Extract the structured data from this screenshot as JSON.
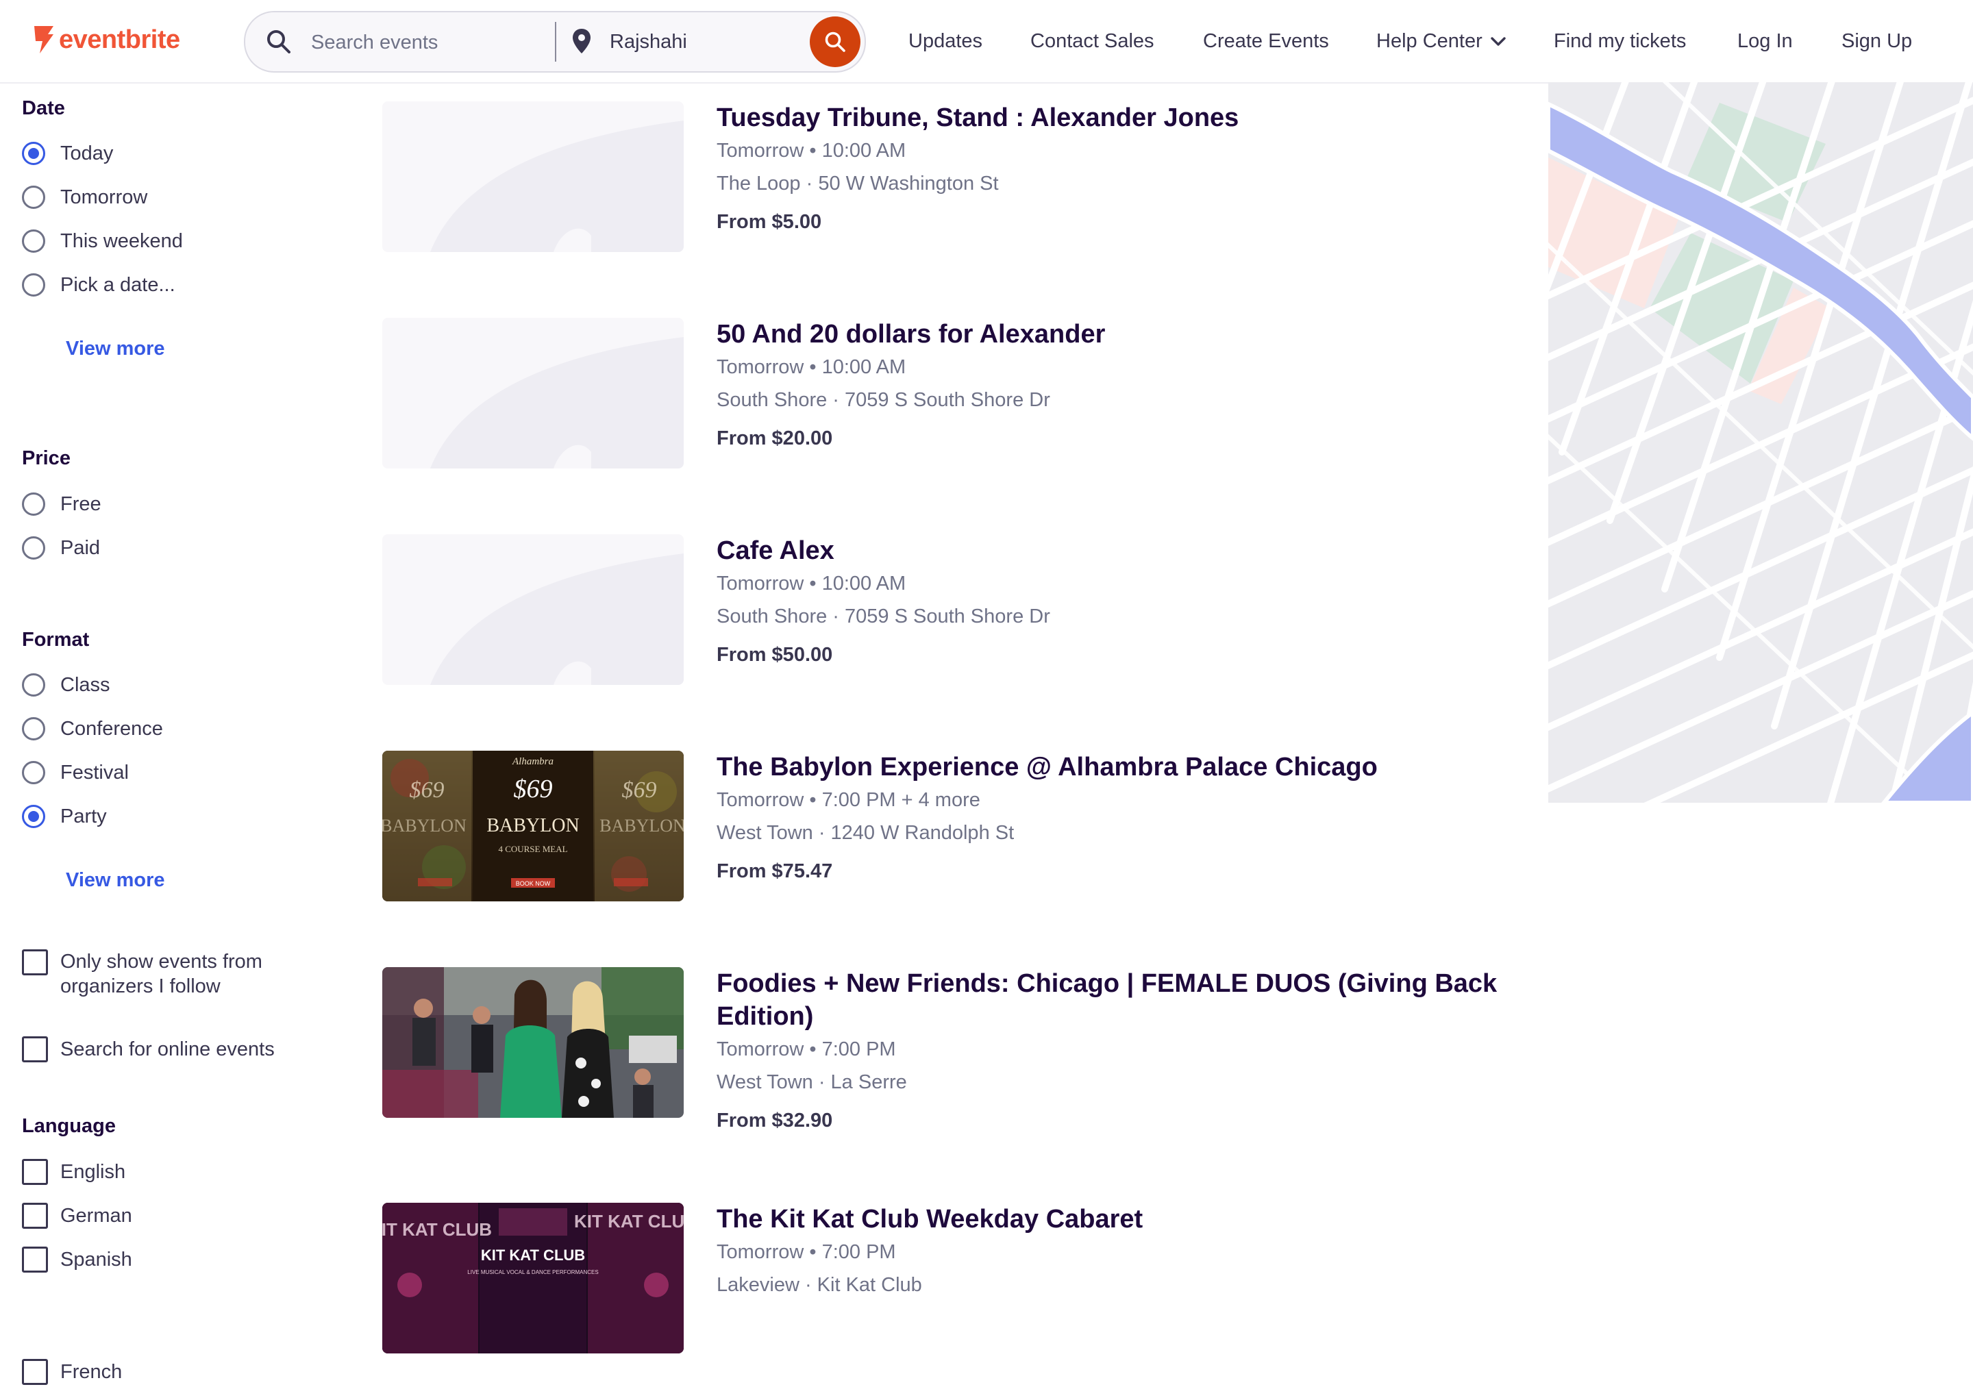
{
  "header": {
    "logo": "eventbrite",
    "search": {
      "placeholder": "Search events",
      "location": "Rajshahi"
    },
    "nav": {
      "updates": "Updates",
      "contact_sales": "Contact Sales",
      "create_events": "Create Events",
      "help_center": "Help Center",
      "find_tickets": "Find my tickets",
      "log_in": "Log In",
      "sign_up": "Sign Up"
    }
  },
  "filters": {
    "date": {
      "title": "Date",
      "options": [
        "Today",
        "Tomorrow",
        "This weekend",
        "Pick a date..."
      ],
      "selected": "Today",
      "view_more": "View more"
    },
    "price": {
      "title": "Price",
      "options": [
        "Free",
        "Paid"
      ]
    },
    "format": {
      "title": "Format",
      "options": [
        "Class",
        "Conference",
        "Festival",
        "Party"
      ],
      "selected": "Party",
      "view_more": "View more"
    },
    "toggles": [
      "Only show events from organizers I follow",
      "Search for online events"
    ],
    "language": {
      "title": "Language",
      "options": [
        "English",
        "German",
        "Spanish",
        "French"
      ]
    }
  },
  "events": [
    {
      "title": "Tuesday Tribune, Stand : Alexander Jones",
      "when": "Tomorrow • 10:00 AM",
      "where": "The Loop · 50 W Washington St",
      "price": "From $5.00",
      "image": "placeholder"
    },
    {
      "title": "50 And 20 dollars for Alexander",
      "when": "Tomorrow • 10:00 AM",
      "where": "South Shore · 7059 S South Shore Dr",
      "price": "From $20.00",
      "image": "placeholder"
    },
    {
      "title": "Cafe Alex",
      "when": "Tomorrow • 10:00 AM",
      "where": "South Shore · 7059 S South Shore Dr",
      "price": "From $50.00",
      "image": "placeholder"
    },
    {
      "title": "The Babylon Experience @ Alhambra Palace Chicago",
      "when": "Tomorrow • 7:00 PM + 4 more",
      "where": "West Town · 1240 W Randolph St",
      "price": "From $75.47",
      "image": "babylon-poster"
    },
    {
      "title": "Foodies + New Friends: Chicago | FEMALE DUOS (Giving Back Edition)",
      "when": "Tomorrow • 7:00 PM",
      "where": "West Town · La Serre",
      "price": "From $32.90",
      "image": "friends-photo"
    },
    {
      "title": "The Kit Kat Club Weekday Cabaret",
      "when": "Tomorrow • 7:00 PM",
      "where": "Lakeview · Kit Kat Club",
      "price": "",
      "image": "kitkat-poster"
    }
  ],
  "posters": {
    "babylon": {
      "brand": "Alhambra",
      "price": "$69",
      "name": "BABYLON",
      "sub": "4 COURSE MEAL",
      "cta": "BOOK NOW"
    },
    "kitkat": {
      "name": "KIT KAT CLUB",
      "sub": "LIVE MUSICAL VOCAL & DANCE PERFORMANCES"
    }
  },
  "colors": {
    "brand": "#f05537",
    "search_button": "#d1410c",
    "link": "#3659e3",
    "title": "#1e0a3c",
    "muted": "#6f7287",
    "map_water": "#aeb8f2",
    "map_park": "#d3e6dc",
    "map_zone": "#fbe6e3"
  }
}
